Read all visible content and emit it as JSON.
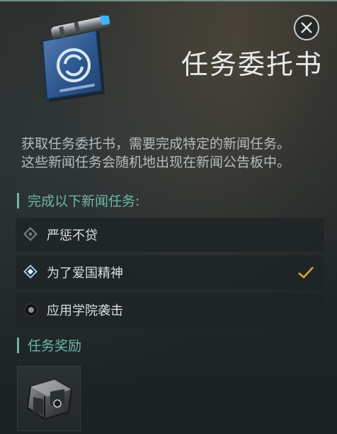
{
  "header": {
    "title": "任务委托书",
    "close_icon": "close-icon",
    "item_icon": "letter-document-icon"
  },
  "description": {
    "line1": "获取任务委托书，需要完成特定的新闻任务。",
    "line2": "这些新闻任务会随机地出现在新闻公告板中。"
  },
  "tasks_section": {
    "title": "完成以下新闻任务:",
    "items": [
      {
        "label": "严惩不贷",
        "state": "incomplete",
        "icon": "diamond-icon"
      },
      {
        "label": "为了爱国精神",
        "state": "completed",
        "icon": "diamond-icon"
      },
      {
        "label": "应用学院袭击",
        "state": "locked",
        "icon": "circle-icon"
      }
    ]
  },
  "rewards_section": {
    "title": "任务奖励",
    "items": [
      {
        "icon": "container-crate-icon"
      }
    ]
  },
  "colors": {
    "accent": "#6fb5a8",
    "check": "#e0a53a",
    "active_marker": "#9ac6ff"
  }
}
